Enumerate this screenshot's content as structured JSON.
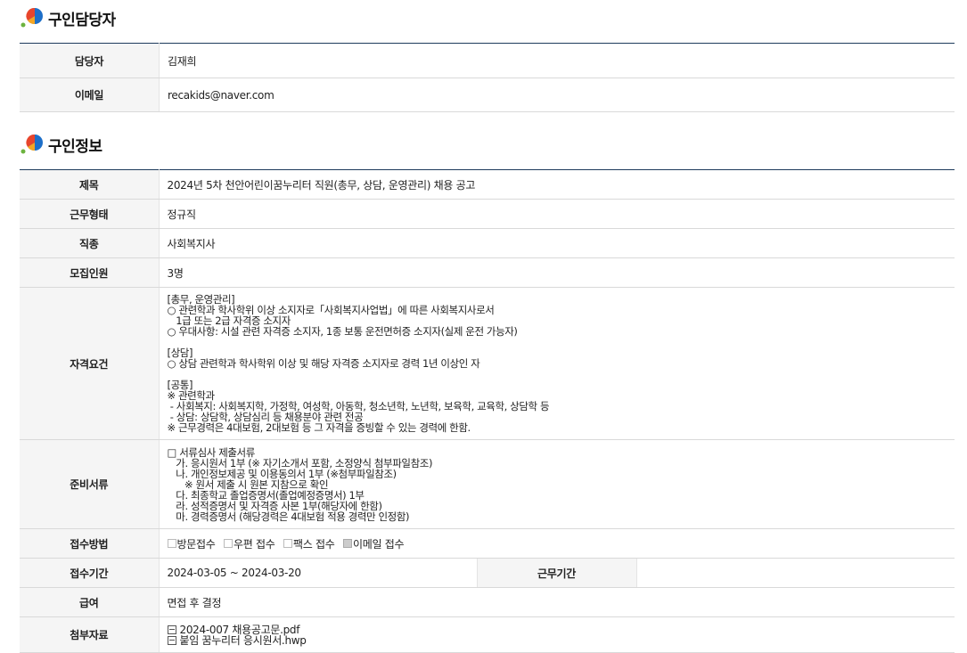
{
  "contact_section": {
    "title": "구인담당자",
    "rows": [
      {
        "label": "담당자",
        "value": "김재희"
      },
      {
        "label": "이메일",
        "value": "recakids@naver.com"
      }
    ]
  },
  "job_section": {
    "title": "구인정보",
    "title_row": {
      "label": "제목",
      "value": "2024년 5차 천안어린이꿈누리터 직원(총무, 상담, 운영관리) 채용 공고"
    },
    "type_row": {
      "label": "근무형태",
      "value": "정규직"
    },
    "occupation_row": {
      "label": "직종",
      "value": "사회복지사"
    },
    "headcount_row": {
      "label": "모집인원",
      "value": "3명"
    },
    "qualification_row": {
      "label": "자격요건",
      "value": "[총무, 운영관리]\n○ 관련학과 학사학위 이상 소지자로「사회복지사업법」에 따른 사회복지사로서\n   1급 또는 2급 자격증 소지자\n○ 우대사항: 시설 관련 자격증 소지자, 1종 보통 운전면허증 소지자(실제 운전 가능자)\n\n[상담]\n○ 상담 관련학과 학사학위 이상 및 해당 자격증 소지자로 경력 1년 이상인 자\n\n[공통]\n※ 관련학과\n - 사회복지: 사회복지학, 가정학, 여성학, 아동학, 청소년학, 노년학, 보육학, 교육학, 상담학 등\n - 상담: 상담학, 상담심리 등 채용분야 관련 전공\n※ 근무경력은 4대보험, 2대보험 등 그 자격을 증빙할 수 있는 경력에 한함."
    },
    "documents_row": {
      "label": "준비서류",
      "value": "□ 서류심사 제출서류\n   가. 응시원서 1부 (※ 자기소개서 포함, 소정양식 첨부파일참조)\n   나. 개인정보제공 및 이용동의서 1부 (※첨부파일참조)\n      ※ 원서 제출 시 원본 지참으로 확인\n   다. 최종학교 졸업증명서(졸업예정증명서) 1부\n   라. 성적증명서 및 자격증 사본 1부(해당자에 한함)\n   마. 경력증명서 (해당경력은 4대보험 적용 경력만 인정함)"
    },
    "method_row": {
      "label": "접수방법",
      "options": [
        {
          "label": "방문접수",
          "checked": false
        },
        {
          "label": "우편 접수",
          "checked": false
        },
        {
          "label": "팩스 접수",
          "checked": false
        },
        {
          "label": "이메일 접수",
          "checked": true
        }
      ]
    },
    "period_row": {
      "label": "접수기간",
      "value": "2024-03-05 ~ 2024-03-20",
      "label2": "근무기간",
      "value2": ""
    },
    "salary_row": {
      "label": "급여",
      "value": "면접 후 결정"
    },
    "attachments_row": {
      "label": "첨부자료",
      "files": [
        "2024-007 채용공고문.pdf",
        "붙임  꿈누리터  응시원서.hwp"
      ]
    }
  },
  "colors": {
    "header_line": "#1e3b5c",
    "label_bg": "#f5f5f5",
    "logo_red": "#e8452c",
    "logo_orange": "#f5a623",
    "logo_blue": "#1d6fc9",
    "logo_green": "#6cb33f"
  }
}
